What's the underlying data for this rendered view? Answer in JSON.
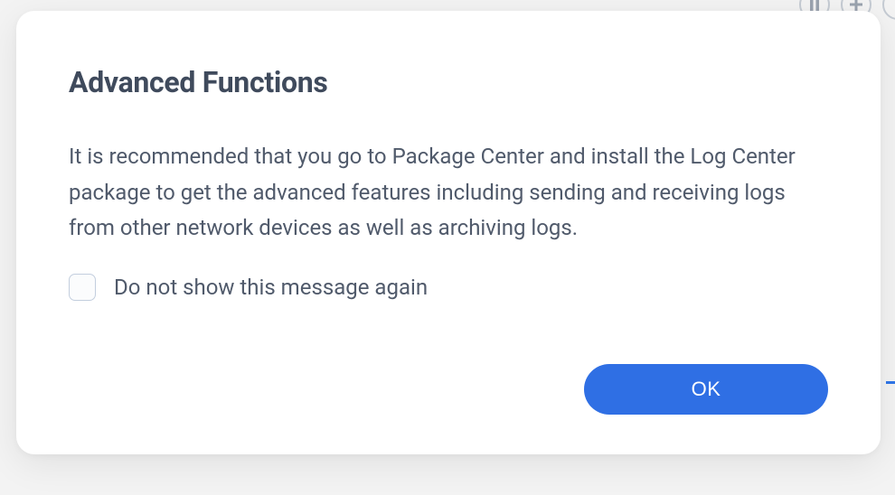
{
  "dialog": {
    "title": "Advanced Functions",
    "body": "It is recommended that you go to Package Center and install the Log Center package to get the advanced features including sending and receiving logs from other network devices as well as archiving logs.",
    "checkbox_label": "Do not show this message again",
    "ok_label": "OK"
  },
  "background": {
    "icon1": "pause-icon",
    "icon2": "plus-icon"
  }
}
